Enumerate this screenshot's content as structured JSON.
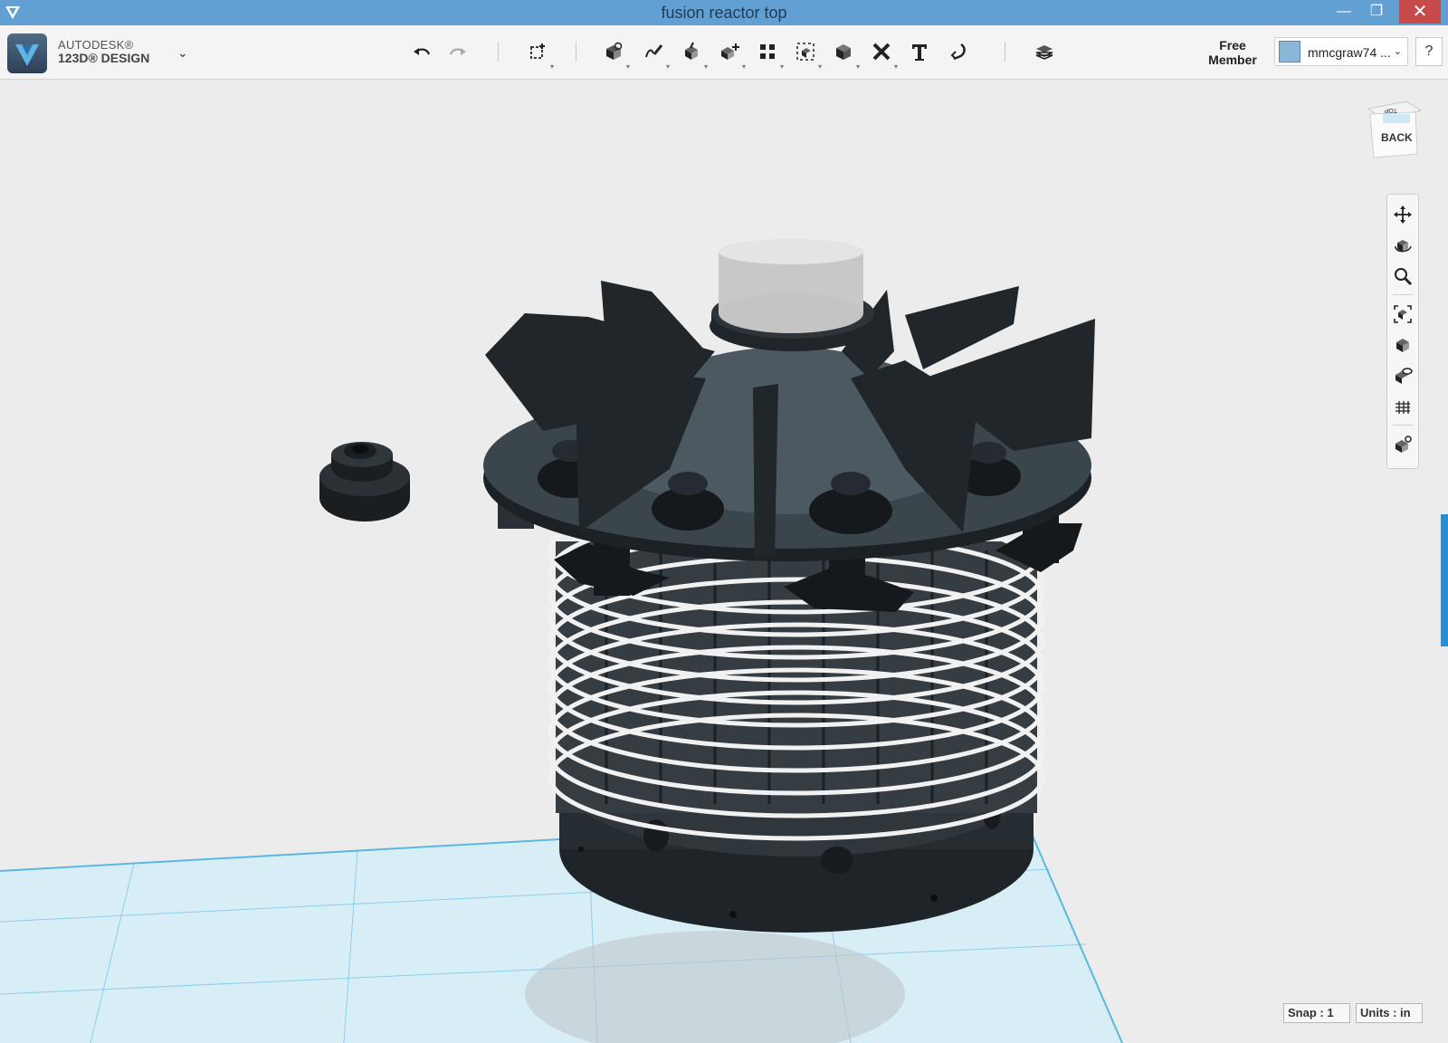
{
  "window": {
    "title": "fusion reactor top",
    "minimize_glyph": "—",
    "maximize_glyph": "❐",
    "close_glyph": "✕"
  },
  "brand": {
    "line1": "AUTODESK®",
    "line2": "123D® DESIGN",
    "menu_icon": "chevron-down-icon"
  },
  "toolbar": {
    "tools": [
      "undo-icon",
      "redo-icon",
      "transform-icon",
      "primitives-icon",
      "sketch-icon",
      "construct-icon",
      "modify-icon",
      "pattern-icon",
      "grouping-icon",
      "combine-icon",
      "measure-icon",
      "text-icon",
      "snap-icon",
      "materials-icon"
    ]
  },
  "account": {
    "membership_line1": "Free",
    "membership_line2": "Member",
    "username": "mmcgraw74 ...",
    "help_label": "?"
  },
  "viewcube": {
    "top_label": "TOP",
    "front_label": "BACK"
  },
  "navbar": {
    "tools": [
      "pan-icon",
      "orbit-icon",
      "zoom-icon",
      "fit-icon",
      "view-mode-icon",
      "visibility-icon",
      "grid-icon",
      "materials-view-icon"
    ]
  },
  "status": {
    "snap": "Snap : 1",
    "units": "Units : in"
  },
  "colors": {
    "titlebar": "#62a0d4",
    "close_button": "#c74a4a",
    "grid_line": "#5ab8e0",
    "grid_fill": "#d8eef7",
    "model_dark": "#2a3238",
    "coil": "#e8e8e8",
    "side_tab": "#2b8ed0"
  }
}
